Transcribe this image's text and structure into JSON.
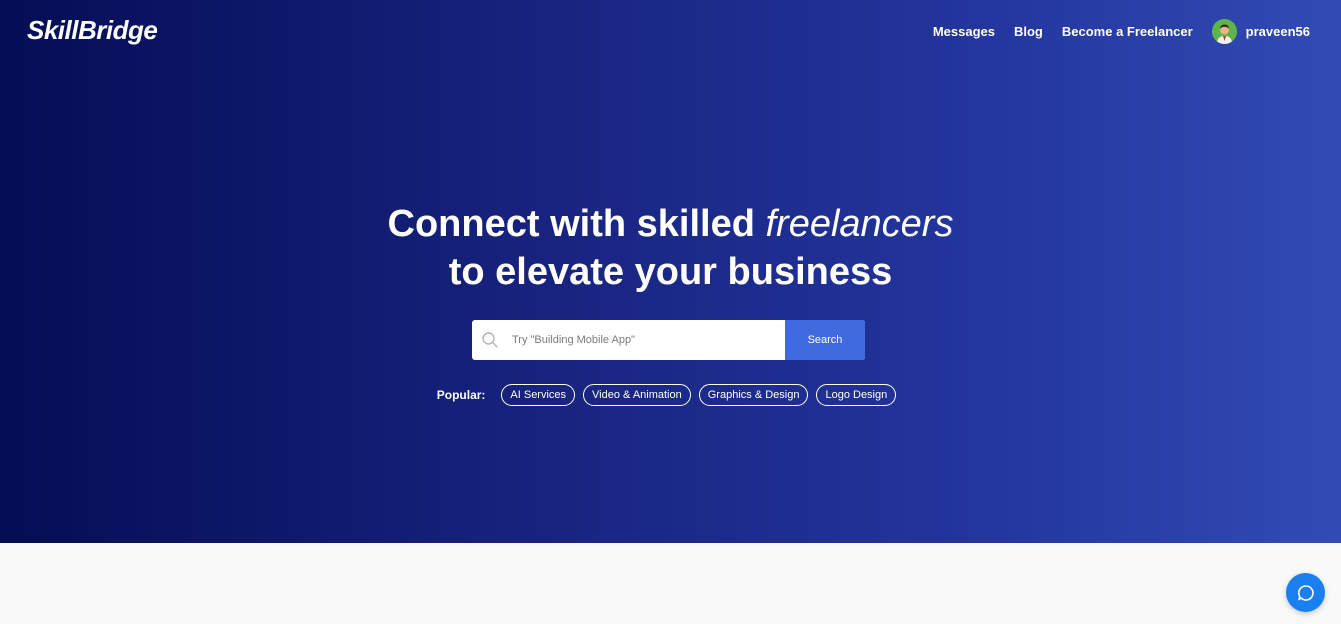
{
  "brand": {
    "name": "SkillBridge"
  },
  "nav": {
    "links": [
      "Messages",
      "Blog",
      "Become a Freelancer"
    ],
    "user": {
      "name": "praveen56"
    }
  },
  "hero": {
    "title_part1": "Connect with skilled",
    "title_accent": "freelancers",
    "title_line2": "to elevate your business"
  },
  "search": {
    "placeholder": "Try \"Building Mobile App\"",
    "value": "",
    "button_label": "Search"
  },
  "popular": {
    "label": "Popular:",
    "tags": [
      "AI Services",
      "Video & Animation",
      "Graphics & Design",
      "Logo Design"
    ]
  },
  "icons": {
    "search": "search-icon",
    "chat": "chat-icon",
    "avatar": "user-avatar"
  },
  "colors": {
    "hero_gradient_start": "#040d55",
    "hero_gradient_end": "#324bb4",
    "search_button": "#3f6ae0",
    "chat_button": "#1a7ff0",
    "page_background": "#f9f9f9"
  }
}
